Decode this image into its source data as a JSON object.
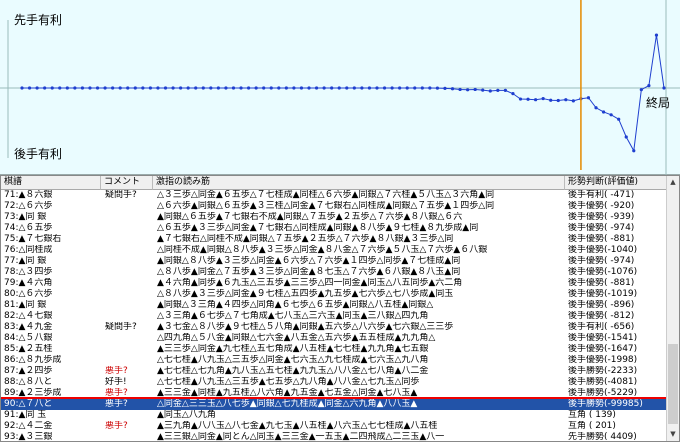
{
  "graph": {
    "label_top": "先手有利",
    "label_bottom": "後手有利",
    "label_end": "終局",
    "evals": [
      0,
      0,
      0,
      0,
      0,
      0,
      0,
      0,
      0,
      0,
      0,
      0,
      0,
      0,
      0,
      0,
      0,
      0,
      0,
      0,
      0,
      0,
      0,
      0,
      0,
      0,
      0,
      0,
      0,
      0,
      0,
      0,
      0,
      0,
      0,
      0,
      0,
      0,
      0,
      0,
      0,
      0,
      0,
      0,
      0,
      0,
      0,
      0,
      0,
      0,
      0,
      0,
      0,
      0,
      0,
      -10,
      -30,
      -60,
      -120,
      -150,
      -120,
      -180,
      -250,
      -200,
      -200,
      -471,
      -920,
      -939,
      -974,
      -881,
      -1019,
      -1040,
      -974,
      -1076,
      -896,
      -812,
      -1647,
      -1998,
      -2233,
      -2600,
      -4081,
      -5229,
      -139,
      201,
      4409,
      0
    ],
    "current_move": 90,
    "colors": {
      "bg": "#eafcff",
      "line": "#1f3fcf",
      "cursor": "#e58a00",
      "bad": "#c0392b"
    }
  },
  "table": {
    "headers": {
      "move": "棋譜",
      "comment": "コメント",
      "line": "激指の読み筋",
      "eval": "形勢判断(評価値)"
    },
    "rows": [
      {
        "move": "71:▲８六銀",
        "comment": "疑問手?",
        "line": "△３三歩△同金▲６五歩△７七桂成▲同桂△６六歩▲同銀△７六桂▲５八玉△３六角▲同",
        "eval": "後手有利( -471)"
      },
      {
        "move": "72:△６六歩",
        "comment": "",
        "line": "△６六歩▲同銀△６五歩▲３三桂△同金▲７七銀右△同桂成▲同銀△７五歩▲１四歩△同",
        "eval": "後手優勢( -920)"
      },
      {
        "move": "73:▲同 銀",
        "comment": "",
        "line": "▲同銀△６五歩▲７七銀右不成▲同銀△７五歩▲２五歩△７六歩▲８八銀△６六",
        "eval": "後手優勢( -939)"
      },
      {
        "move": "74:△６五歩",
        "comment": "",
        "line": "△６五歩▲３三歩△同金▲７七銀右△同桂成▲同銀▲８八歩▲９七桂▲８九歩成▲同",
        "eval": "後手優勢( -974)"
      },
      {
        "move": "75:▲７七銀右",
        "comment": "",
        "line": "▲７七銀右△同桂不成▲同銀△７五歩▲２五歩△７六歩▲８八銀▲３三歩△同",
        "eval": "後手優勢( -881)"
      },
      {
        "move": "76:△同桂成",
        "comment": "",
        "line": "△同桂不成▲同銀△８八歩▲３三歩△同金▲８八金△７六歩▲５八玉△７六歩▲６八銀",
        "eval": "後手優勢(-1040)"
      },
      {
        "move": "77:▲同 銀",
        "comment": "",
        "line": "▲同銀△８八歩▲３三歩△同金▲６六歩△７六歩▲１四歩△同歩▲７七桂成▲同",
        "eval": "後手優勢( -974)"
      },
      {
        "move": "78:△３四歩",
        "comment": "",
        "line": "△８八歩▲同金△７五歩▲３三歩△同金▲８七玉△７六歩▲６八銀▲８八玉▲同",
        "eval": "後手優勢(-1076)"
      },
      {
        "move": "79:▲４六角",
        "comment": "",
        "line": "▲４六角▲同歩▲６九玉△三五歩▲三三歩△四一同金▲同玉△八五同歩▲六二角",
        "eval": "後手優勢( -881)"
      },
      {
        "move": "80:△６六歩",
        "comment": "",
        "line": "△８八歩▲３三歩△同金▲９七桂△五四歩▲九五歩▲七六歩△七八歩成▲同玉",
        "eval": "後手優勢(-1019)"
      },
      {
        "move": "81:▲同 銀",
        "comment": "",
        "line": "▲同銀△３三角▲４四歩△同角▲６七歩△６五歩▲同銀△八五桂▲同銀△",
        "eval": "後手優勢( -896)"
      },
      {
        "move": "82:△４七銀",
        "comment": "",
        "line": "△３三角▲６七歩△７七角成▲七八玉△三六玉▲同玉▲三八銀△四九角",
        "eval": "後手優勢( -812)"
      },
      {
        "move": "83:▲４九金",
        "comment": "疑問手?",
        "line": "▲３七金△８八歩▲９七桂△５八角▲同銀▲五六歩△八六歩▲七六銀△三三歩",
        "eval": "後手有利( -656)"
      },
      {
        "move": "84:△５八銀",
        "comment": "",
        "line": "△四九角△５八金▲同銀△七六金▲八五金△五六歩▲五五桂成▲九九角△",
        "eval": "後手優勢(-1541)"
      },
      {
        "move": "85:▲２五桂",
        "comment": "",
        "line": "▲三三歩△同金▲九七桂△五七角成▲八五桂▲七七桂▲九九角▲七五銀",
        "eval": "後手優勢(-1647)"
      },
      {
        "move": "86:△８九歩成",
        "comment": "",
        "line": "△七七桂▲八九玉△三五歩△同金▲七六玉△九七桂成▲七六玉△九八角",
        "eval": "後手優勢(-1998)"
      },
      {
        "move": "87:▲２四歩",
        "comment": "悪手?",
        "line": "▲七七桂△七九角▲九八玉△五七桂▲九九玉△八八金△七八角▲八二金",
        "eval": "後手勝勢(-2233)"
      },
      {
        "move": "88:△８八と",
        "comment": "好手!",
        "line": "△七七桂▲八九玉△三五歩▲七五歩△九八角▲八八金△七九玉△同歩",
        "eval": "後手勝勢(-4081)"
      },
      {
        "move": "89:▲２三歩成",
        "comment": "悪手?",
        "line": "▲三三金▲同桂▲九五桂△八六角▲九五金▲七五金△同金▲七八玉▲",
        "eval": "後手勝勢(-5229)"
      },
      {
        "move": "90:△７八と",
        "comment": "悪手?",
        "line": "△同金△三三玉△八七歩▲同銀△七九桂成▲同金△六九角▲八八玉▲",
        "eval": "後手勝勢(-99985)"
      },
      {
        "move": "91:▲同 玉",
        "comment": "",
        "line": "▲同玉△八九角",
        "eval": "互角 ( 139)"
      },
      {
        "move": "92:△４二金",
        "comment": "悪手?",
        "line": "▲三九角▲八八玉△八七金▲九七玉▲八五桂▲八六玉△七七桂成▲八五桂",
        "eval": "互角 ( 201)"
      },
      {
        "move": "93:▲３三銀",
        "comment": "",
        "line": "▲三三銀△同金▲同とん△同玉▲三三金▲一五玉▲二四飛成△二三玉▲八一",
        "eval": "先手勝勢( 4409)"
      }
    ]
  }
}
